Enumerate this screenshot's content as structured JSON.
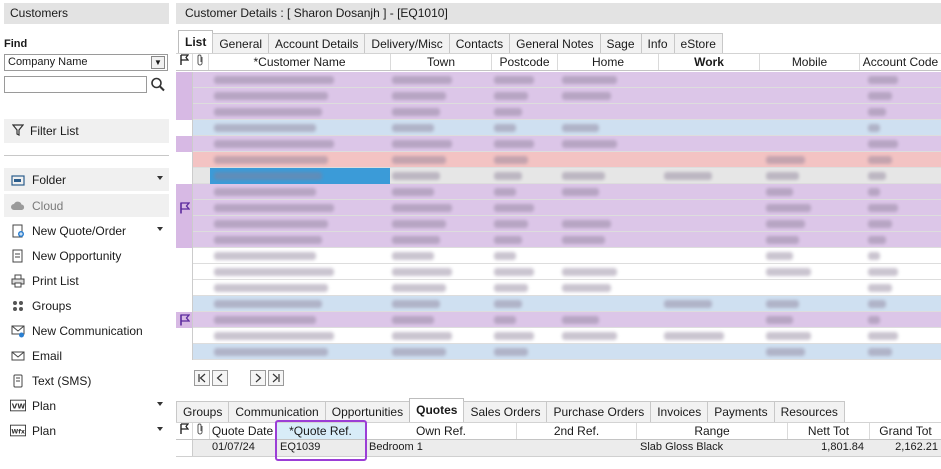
{
  "left_panel": {
    "header": "Customers",
    "find_label": "Find",
    "find_field_selected": "Company Name",
    "search_value": "",
    "filter_list": "Filter List",
    "actions": [
      {
        "label": "Folder",
        "icon": "folder-icon",
        "has_menu": true,
        "enabled": true
      },
      {
        "label": "Cloud",
        "icon": "cloud-icon",
        "has_menu": false,
        "enabled": false
      },
      {
        "label": "New Quote/Order",
        "icon": "new-quote-icon",
        "has_menu": true,
        "enabled": true
      },
      {
        "label": "New Opportunity",
        "icon": "new-opportunity-icon",
        "has_menu": false,
        "enabled": true
      },
      {
        "label": "Print List",
        "icon": "printer-icon",
        "has_menu": false,
        "enabled": true
      },
      {
        "label": "Groups",
        "icon": "groups-icon",
        "has_menu": false,
        "enabled": true
      },
      {
        "label": "New Communication",
        "icon": "new-communication-icon",
        "has_menu": false,
        "enabled": true
      },
      {
        "label": "Email",
        "icon": "email-icon",
        "has_menu": false,
        "enabled": true
      },
      {
        "label": "Text (SMS)",
        "icon": "sms-icon",
        "has_menu": false,
        "enabled": true
      },
      {
        "label": "Plan",
        "icon": "plan-vw-icon",
        "has_menu": true,
        "enabled": true
      },
      {
        "label": "Plan",
        "icon": "plan-wfx-icon",
        "has_menu": true,
        "enabled": true
      }
    ]
  },
  "title": "Customer Details : [ Sharon Dosanjh ]  -  [EQ1010]",
  "top_tabs": [
    "List",
    "General",
    "Account Details",
    "Delivery/Misc",
    "Contacts",
    "General Notes",
    "Sage",
    "Info",
    "eStore"
  ],
  "active_top_tab": "List",
  "list_grid": {
    "columns": [
      "*Customer Name",
      "Town",
      "Postcode",
      "Home",
      "Work",
      "Mobile",
      "Account Code"
    ],
    "sorted_column": "Work",
    "rows_note_blurred": true,
    "row_colors": {
      "violet": "#dcc6e8",
      "blue": "#cfe0f1",
      "pink": "#f3c3c3",
      "white": "#ffffff",
      "grey": "#e6e6e6"
    },
    "rows": [
      {
        "color": "violet",
        "flag": false
      },
      {
        "color": "violet",
        "flag": false
      },
      {
        "color": "violet",
        "flag": false
      },
      {
        "color": "blue",
        "flag": false
      },
      {
        "color": "violet",
        "flag": false
      },
      {
        "color": "pink",
        "flag": false
      },
      {
        "color": "grey",
        "flag": false,
        "selected": true
      },
      {
        "color": "violet",
        "flag": false
      },
      {
        "color": "violet",
        "flag": true
      },
      {
        "color": "violet",
        "flag": false
      },
      {
        "color": "violet",
        "flag": false
      },
      {
        "color": "white",
        "flag": false
      },
      {
        "color": "white",
        "flag": false
      },
      {
        "color": "white",
        "flag": false
      },
      {
        "color": "blue",
        "flag": false
      },
      {
        "color": "violet",
        "flag": true
      },
      {
        "color": "white",
        "flag": false
      },
      {
        "color": "blue",
        "flag": false
      }
    ]
  },
  "bottom_tabs": [
    "Groups",
    "Communication",
    "Opportunities",
    "Quotes",
    "Sales Orders",
    "Purchase Orders",
    "Invoices",
    "Payments",
    "Resources"
  ],
  "active_bottom_tab": "Quotes",
  "quotes_grid": {
    "columns": [
      "Quote Date",
      "*Quote Ref.",
      "Own Ref.",
      "2nd Ref.",
      "Range",
      "Nett Tot",
      "Grand Tot"
    ],
    "rows": [
      {
        "quote_date": "01/07/24",
        "quote_ref": "EQ1039",
        "own_ref": "Bedroom 1",
        "second_ref": "",
        "range": "Slab Gloss Black",
        "nett_tot": "1,801.84",
        "grand_tot": "2,162.21"
      }
    ]
  },
  "accent_highlight_color": "#9b3ed6"
}
